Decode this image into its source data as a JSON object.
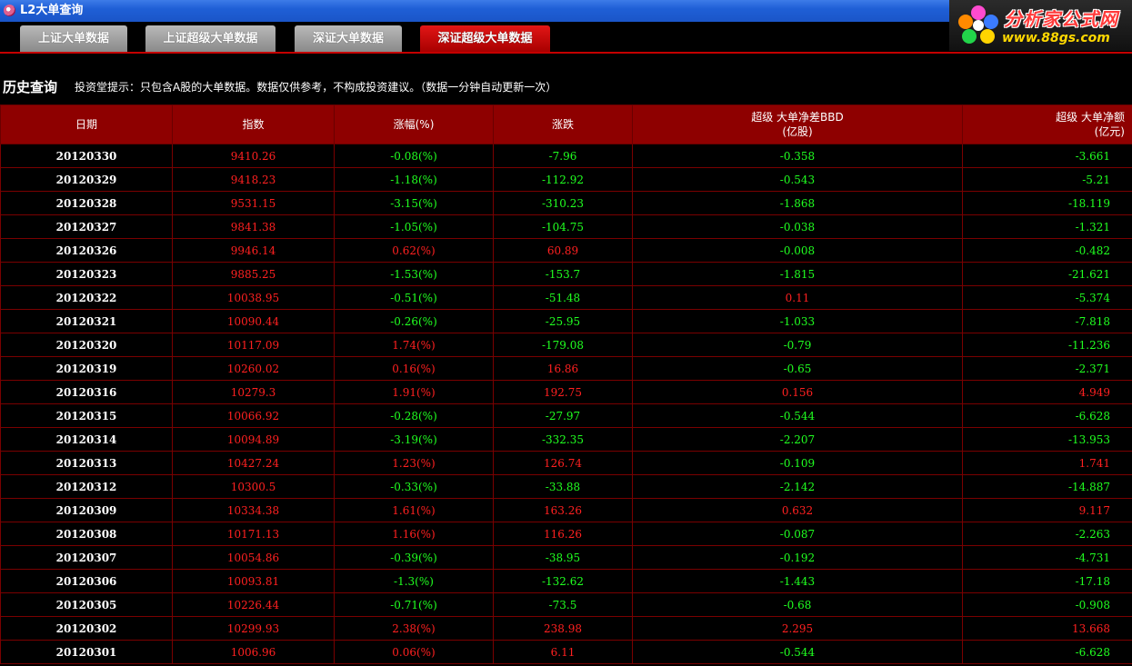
{
  "window": {
    "title": "L2大单查询"
  },
  "logo": {
    "brand_cn": "分析家公式网",
    "url": "www.88gs.com"
  },
  "tabs": [
    {
      "label": "上证大单数据",
      "active": false
    },
    {
      "label": "上证超级大单数据",
      "active": false
    },
    {
      "label": "深证大单数据",
      "active": false
    },
    {
      "label": "深证超级大单数据",
      "active": true
    }
  ],
  "history": {
    "title": "历史查询",
    "hint": "投资堂提示：只包含A股的大单数据。数据仅供参考，不构成投资建议。（数据一分钟自动更新一次）"
  },
  "columns": [
    "日期",
    "指数",
    "涨幅(%)",
    "涨跌",
    "超级 大单净差BBD",
    "(亿股)",
    "超级 大单净额",
    "(亿元)"
  ],
  "colors": {
    "up": "#ff2020",
    "down": "#20ff20",
    "header": "#8e0000",
    "border": "#7a0000"
  },
  "rows": [
    {
      "date": "20120330",
      "index": "9410.26",
      "pct": "-0.08(%)",
      "chg": "-7.96",
      "bbd": "-0.358",
      "amt": "-3.661"
    },
    {
      "date": "20120329",
      "index": "9418.23",
      "pct": "-1.18(%)",
      "chg": "-112.92",
      "bbd": "-0.543",
      "amt": "-5.21"
    },
    {
      "date": "20120328",
      "index": "9531.15",
      "pct": "-3.15(%)",
      "chg": "-310.23",
      "bbd": "-1.868",
      "amt": "-18.119"
    },
    {
      "date": "20120327",
      "index": "9841.38",
      "pct": "-1.05(%)",
      "chg": "-104.75",
      "bbd": "-0.038",
      "amt": "-1.321"
    },
    {
      "date": "20120326",
      "index": "9946.14",
      "pct": "0.62(%)",
      "chg": "60.89",
      "bbd": "-0.008",
      "amt": "-0.482"
    },
    {
      "date": "20120323",
      "index": "9885.25",
      "pct": "-1.53(%)",
      "chg": "-153.7",
      "bbd": "-1.815",
      "amt": "-21.621"
    },
    {
      "date": "20120322",
      "index": "10038.95",
      "pct": "-0.51(%)",
      "chg": "-51.48",
      "bbd": "0.11",
      "amt": "-5.374"
    },
    {
      "date": "20120321",
      "index": "10090.44",
      "pct": "-0.26(%)",
      "chg": "-25.95",
      "bbd": "-1.033",
      "amt": "-7.818"
    },
    {
      "date": "20120320",
      "index": "10117.09",
      "pct": "1.74(%)",
      "chg": "-179.08",
      "bbd": "-0.79",
      "amt": "-11.236"
    },
    {
      "date": "20120319",
      "index": "10260.02",
      "pct": "0.16(%)",
      "chg": "16.86",
      "bbd": "-0.65",
      "amt": "-2.371"
    },
    {
      "date": "20120316",
      "index": "10279.3",
      "pct": "1.91(%)",
      "chg": "192.75",
      "bbd": "0.156",
      "amt": "4.949"
    },
    {
      "date": "20120315",
      "index": "10066.92",
      "pct": "-0.28(%)",
      "chg": "-27.97",
      "bbd": "-0.544",
      "amt": "-6.628"
    },
    {
      "date": "20120314",
      "index": "10094.89",
      "pct": "-3.19(%)",
      "chg": "-332.35",
      "bbd": "-2.207",
      "amt": "-13.953"
    },
    {
      "date": "20120313",
      "index": "10427.24",
      "pct": "1.23(%)",
      "chg": "126.74",
      "bbd": "-0.109",
      "amt": "1.741"
    },
    {
      "date": "20120312",
      "index": "10300.5",
      "pct": "-0.33(%)",
      "chg": "-33.88",
      "bbd": "-2.142",
      "amt": "-14.887"
    },
    {
      "date": "20120309",
      "index": "10334.38",
      "pct": "1.61(%)",
      "chg": "163.26",
      "bbd": "0.632",
      "amt": "9.117"
    },
    {
      "date": "20120308",
      "index": "10171.13",
      "pct": "1.16(%)",
      "chg": "116.26",
      "bbd": "-0.087",
      "amt": "-2.263"
    },
    {
      "date": "20120307",
      "index": "10054.86",
      "pct": "-0.39(%)",
      "chg": "-38.95",
      "bbd": "-0.192",
      "amt": "-4.731"
    },
    {
      "date": "20120306",
      "index": "10093.81",
      "pct": "-1.3(%)",
      "chg": "-132.62",
      "bbd": "-1.443",
      "amt": "-17.18"
    },
    {
      "date": "20120305",
      "index": "10226.44",
      "pct": "-0.71(%)",
      "chg": "-73.5",
      "bbd": "-0.68",
      "amt": "-0.908"
    },
    {
      "date": "20120302",
      "index": "10299.93",
      "pct": "2.38(%)",
      "chg": "238.98",
      "bbd": "2.295",
      "amt": "13.668"
    },
    {
      "date": "20120301",
      "index": "1006.96",
      "pct": "0.06(%)",
      "chg": "6.11",
      "bbd": "-0.544",
      "amt": "-6.628"
    }
  ]
}
